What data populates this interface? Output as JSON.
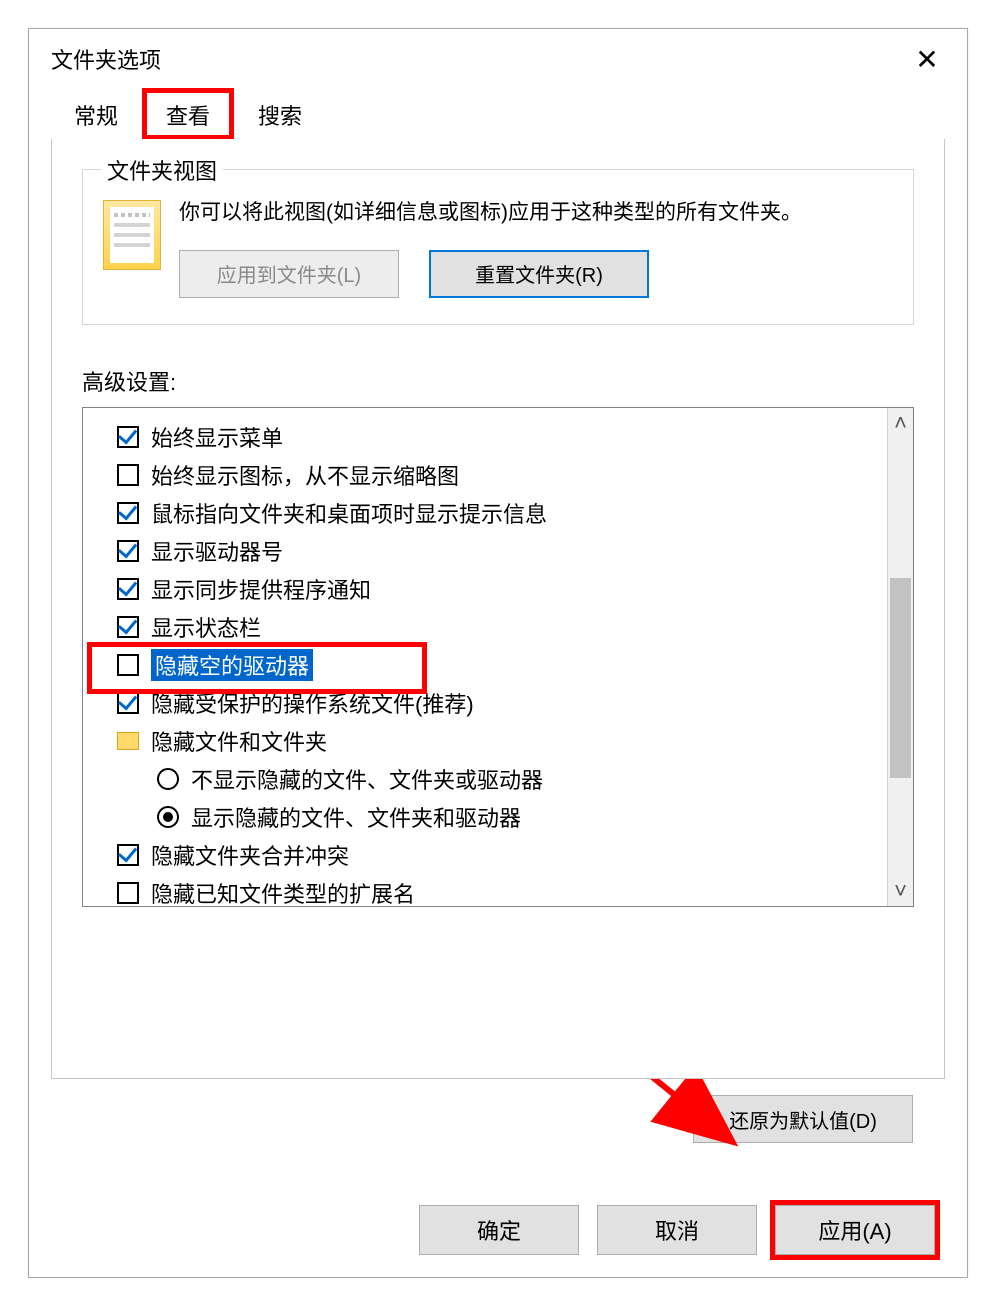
{
  "dialog": {
    "title": "文件夹选项"
  },
  "tabs": {
    "general": "常规",
    "view": "查看",
    "search": "搜索"
  },
  "group": {
    "legend": "文件夹视图",
    "desc": "你可以将此视图(如详细信息或图标)应用于这种类型的所有文件夹。",
    "apply_folders": "应用到文件夹(L)",
    "reset_folders": "重置文件夹(R)"
  },
  "adv": {
    "label": "高级设置:",
    "items": [
      {
        "type": "checkbox",
        "checked": true,
        "label": "始终显示菜单"
      },
      {
        "type": "checkbox",
        "checked": false,
        "label": "始终显示图标，从不显示缩略图"
      },
      {
        "type": "checkbox",
        "checked": true,
        "label": "鼠标指向文件夹和桌面项时显示提示信息"
      },
      {
        "type": "checkbox",
        "checked": true,
        "label": "显示驱动器号"
      },
      {
        "type": "checkbox",
        "checked": true,
        "label": "显示同步提供程序通知"
      },
      {
        "type": "checkbox",
        "checked": true,
        "label": "显示状态栏"
      },
      {
        "type": "checkbox",
        "checked": false,
        "label": "隐藏空的驱动器",
        "selected": true
      },
      {
        "type": "checkbox",
        "checked": true,
        "label": "隐藏受保护的操作系统文件(推荐)"
      },
      {
        "type": "folder",
        "label": "隐藏文件和文件夹"
      },
      {
        "type": "radio",
        "checked": false,
        "label": "不显示隐藏的文件、文件夹或驱动器",
        "indent": 1
      },
      {
        "type": "radio",
        "checked": true,
        "label": "显示隐藏的文件、文件夹和驱动器",
        "indent": 1
      },
      {
        "type": "checkbox",
        "checked": true,
        "label": "隐藏文件夹合并冲突"
      },
      {
        "type": "checkbox",
        "checked": false,
        "label": "隐藏已知文件类型的扩展名"
      }
    ]
  },
  "restore_defaults": "还原为默认值(D)",
  "footer": {
    "ok": "确定",
    "cancel": "取消",
    "apply": "应用(A)"
  }
}
